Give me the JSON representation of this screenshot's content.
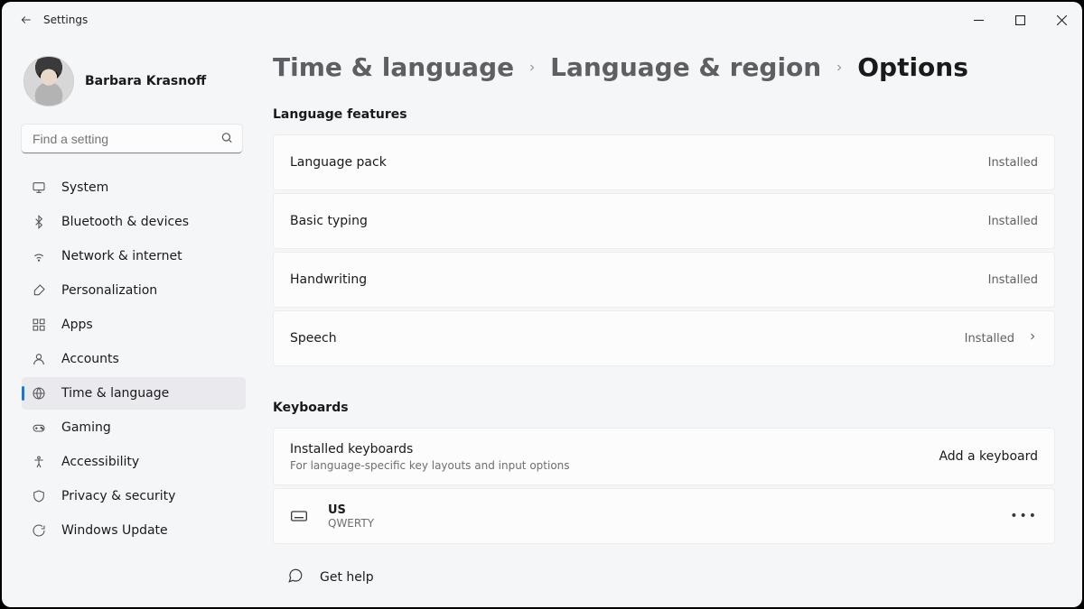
{
  "titlebar": {
    "back_aria": "Back",
    "title": "Settings"
  },
  "profile": {
    "name": "Barbara Krasnoff"
  },
  "search": {
    "placeholder": "Find a setting"
  },
  "sidebar": {
    "items": [
      {
        "label": "System",
        "icon": "monitor",
        "active": false
      },
      {
        "label": "Bluetooth & devices",
        "icon": "bluetooth",
        "active": false
      },
      {
        "label": "Network & internet",
        "icon": "wifi",
        "active": false
      },
      {
        "label": "Personalization",
        "icon": "brush",
        "active": false
      },
      {
        "label": "Apps",
        "icon": "apps",
        "active": false
      },
      {
        "label": "Accounts",
        "icon": "person",
        "active": false
      },
      {
        "label": "Time & language",
        "icon": "globe-clock",
        "active": true
      },
      {
        "label": "Gaming",
        "icon": "gamepad",
        "active": false
      },
      {
        "label": "Accessibility",
        "icon": "accessibility",
        "active": false
      },
      {
        "label": "Privacy & security",
        "icon": "shield",
        "active": false
      },
      {
        "label": "Windows Update",
        "icon": "update",
        "active": false
      }
    ]
  },
  "breadcrumbs": {
    "parts": [
      "Time & language",
      "Language & region",
      "Options"
    ]
  },
  "sections": {
    "language_features": {
      "label": "Language features",
      "items": [
        {
          "label": "Language pack",
          "status": "Installed",
          "chevron": false
        },
        {
          "label": "Basic typing",
          "status": "Installed",
          "chevron": false
        },
        {
          "label": "Handwriting",
          "status": "Installed",
          "chevron": false
        },
        {
          "label": "Speech",
          "status": "Installed",
          "chevron": true
        }
      ]
    },
    "keyboards": {
      "label": "Keyboards",
      "header": {
        "title": "Installed keyboards",
        "subtitle": "For language-specific key layouts and input options",
        "action": "Add a keyboard"
      },
      "items": [
        {
          "name": "US",
          "layout": "QWERTY"
        }
      ]
    }
  },
  "gethelp": {
    "label": "Get help"
  }
}
